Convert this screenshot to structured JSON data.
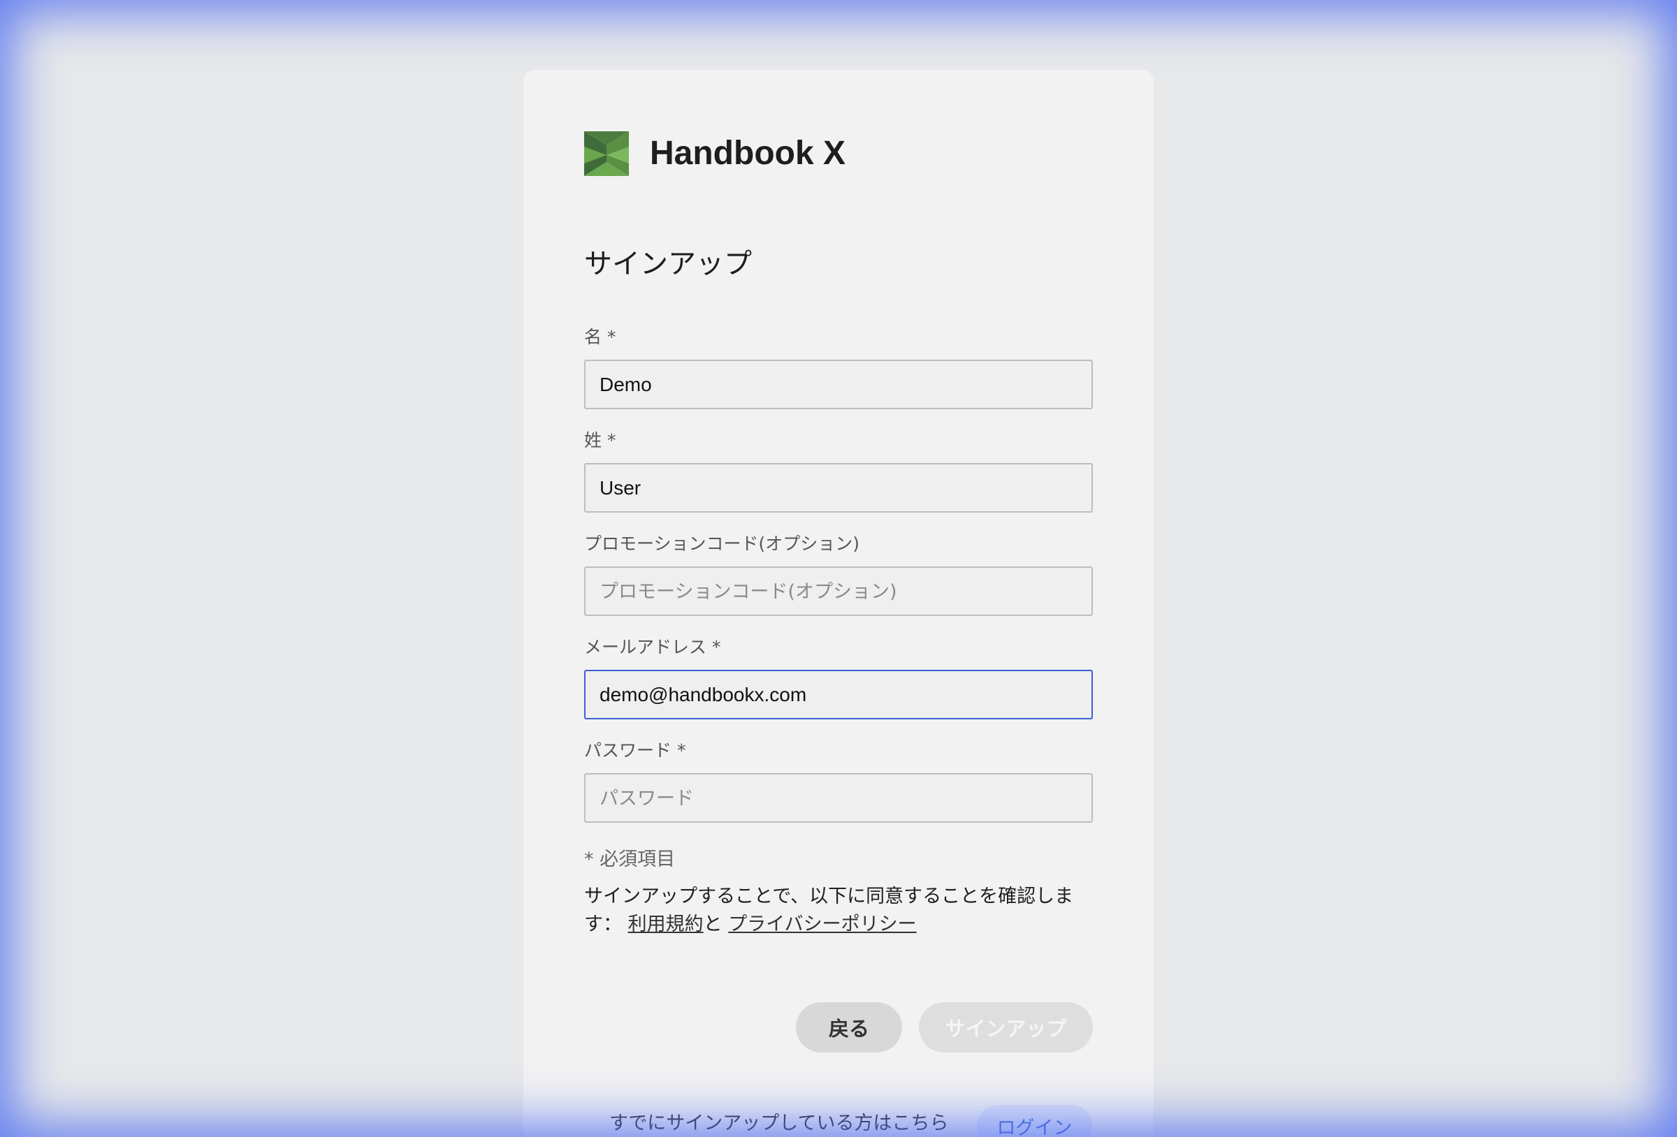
{
  "brand": {
    "name": "Handbook X"
  },
  "heading": "サインアップ",
  "fields": {
    "first_name": {
      "label": "名 *",
      "value": "Demo",
      "placeholder": ""
    },
    "last_name": {
      "label": "姓 *",
      "value": "User",
      "placeholder": ""
    },
    "promo_code": {
      "label": "プロモーションコード(オプション)",
      "value": "",
      "placeholder": "プロモーションコード(オプション)"
    },
    "email": {
      "label": "メールアドレス *",
      "value": "demo@handbookx.com",
      "placeholder": ""
    },
    "password": {
      "label": "パスワード *",
      "value": "",
      "placeholder": "パスワード"
    }
  },
  "required_note": "* 必須項目",
  "agreement": {
    "text": "サインアップすることで、以下に同意することを確認します：",
    "terms_link": "利用規約",
    "conjunction": "と",
    "privacy_link": "プライバシーポリシー"
  },
  "buttons": {
    "back_label": "戻る",
    "signup_label": "サインアップ"
  },
  "footer": {
    "text": "すでにサインアップしている方はこちら",
    "login_label": "ログイン"
  },
  "colors": {
    "background": "#e7e8ea",
    "card": "#f2f2f2",
    "focus_border": "#3b5fd9",
    "focus_glow": "#5a78f0",
    "logo_dark": "#3f6b3a",
    "logo_light": "#6aa84f",
    "login_text": "#4a6ad8"
  },
  "icons": {
    "logo": "handbook-x-logo-icon"
  }
}
